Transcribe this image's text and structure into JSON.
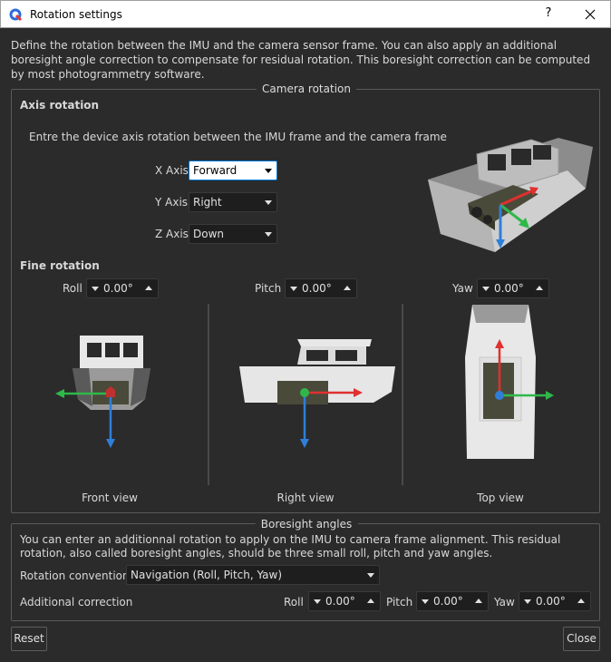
{
  "window": {
    "title": "Rotation settings",
    "help_label": "?"
  },
  "intro_text": "Define the rotation between the IMU and the camera sensor frame. You can also apply an additional boresight angle correction to compensate for residual rotation. This boresight correction can be computed by most photogrammetry software.",
  "camera_rotation": {
    "title": "Camera rotation",
    "axis_rotation": {
      "heading": "Axis rotation",
      "description": "Entre the device axis rotation between the IMU frame and the camera frame",
      "x_label": "X Axis",
      "x_value": "Forward",
      "y_label": "Y Axis",
      "y_value": "Right",
      "z_label": "Z Axis",
      "z_value": "Down"
    },
    "fine_rotation": {
      "heading": "Fine rotation",
      "roll_label": "Roll",
      "roll_value": "0.00°",
      "pitch_label": "Pitch",
      "pitch_value": "0.00°",
      "yaw_label": "Yaw",
      "yaw_value": "0.00°"
    },
    "views": {
      "front": "Front view",
      "right": "Right view",
      "top": "Top view"
    }
  },
  "boresight": {
    "title": "Boresight angles",
    "description": "You can enter an additionnal rotation to apply on the IMU to camera frame alignment. This residual rotation, also called boresight angles, should be three small roll, pitch and yaw angles.",
    "convention_label": "Rotation convention",
    "convention_value": "Navigation (Roll, Pitch, Yaw)",
    "correction_label": "Additional correction",
    "roll_label": "Roll",
    "roll_value": "0.00°",
    "pitch_label": "Pitch",
    "pitch_value": "0.00°",
    "yaw_label": "Yaw",
    "yaw_value": "0.00°"
  },
  "buttons": {
    "reset": "Reset",
    "close": "Close"
  },
  "colors": {
    "axis_x": "#e03030",
    "axis_y": "#2fb84a",
    "axis_z": "#2f7fd8",
    "accent": "#0078d7"
  },
  "icons": [
    "app-logo-icon",
    "close-icon",
    "chevron-down-icon",
    "chevron-up-icon"
  ]
}
